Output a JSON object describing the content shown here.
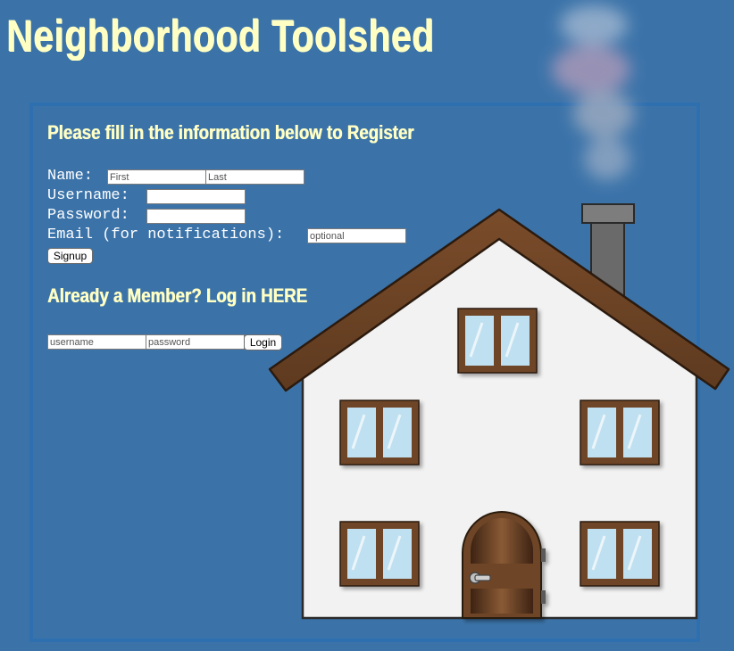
{
  "header": {
    "title": "Neighborhood Toolshed"
  },
  "register": {
    "heading": "Please fill in the information below to Register",
    "name_label": "Name:",
    "first_placeholder": "First",
    "last_placeholder": "Last",
    "username_label": "Username:",
    "password_label": "Password:",
    "email_label": "Email (for notifications):",
    "email_placeholder": "optional",
    "signup_label": "Signup"
  },
  "login": {
    "heading": "Already a Member? Log in HERE",
    "username_placeholder": "username",
    "password_placeholder": "password",
    "login_label": "Login"
  },
  "colors": {
    "background": "#3b73a9",
    "heading_text": "#ffffc4",
    "panel_border": "#2e6fb0",
    "roof": "#6e4527",
    "window_frame": "#6e4527",
    "glass": "#bfe0f0"
  },
  "icons": {
    "illustration": "house-with-smoking-chimney"
  }
}
